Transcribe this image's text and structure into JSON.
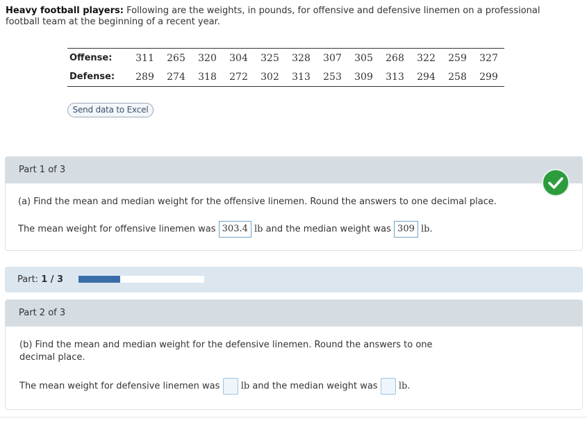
{
  "intro": {
    "title": "Heavy football players:",
    "text": " Following are the weights, in pounds, for offensive and defensive linemen on a professional football team at the beginning of a recent year."
  },
  "table": {
    "offense_label": "Offense:",
    "defense_label": "Defense:",
    "offense": [
      "311",
      "265",
      "320",
      "304",
      "325",
      "328",
      "307",
      "305",
      "268",
      "322",
      "259",
      "327"
    ],
    "defense": [
      "289",
      "274",
      "318",
      "272",
      "302",
      "313",
      "253",
      "309",
      "313",
      "294",
      "258",
      "299"
    ]
  },
  "excel_button": "Send data to Excel",
  "part1": {
    "header": "Part 1 of 3",
    "question": "(a) Find the mean and median weight for the offensive linemen. Round the answers to one decimal place.",
    "sentence_a": "The mean weight for offensive linemen was",
    "mean_value": "303.4",
    "unit_a": "lb",
    "sentence_b": "and the median weight was",
    "median_value": "309",
    "unit_b": "lb."
  },
  "progress": {
    "label_prefix": "Part: ",
    "label_value": "1 / 3",
    "fraction": 0.333
  },
  "part2": {
    "header": "Part 2 of 3",
    "question": "(b) Find the mean and median weight for the defensive linemen. Round the answers to one decimal place.",
    "sentence_a": "The mean weight for defensive linemen was",
    "unit_a": "lb",
    "sentence_b": "and the median weight was",
    "unit_b": "lb."
  },
  "colors": {
    "check_green": "#2c9c3e",
    "progress_fill": "#3a6ea8",
    "header_gray": "#d5dce2"
  }
}
